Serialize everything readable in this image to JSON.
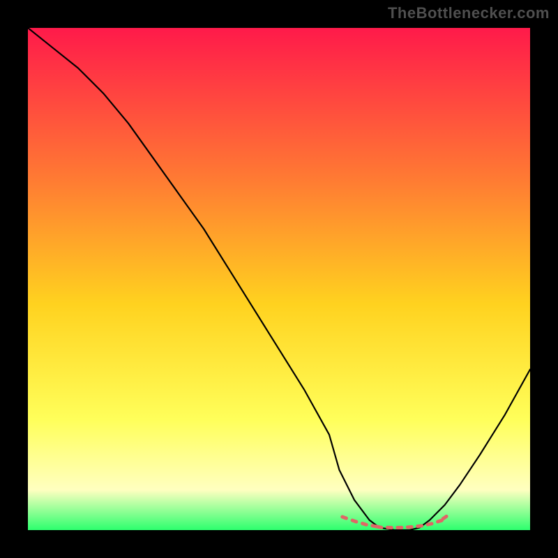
{
  "watermark": "TheBottlenecker.com",
  "chart_data": {
    "type": "line",
    "title": "",
    "xlabel": "",
    "ylabel": "",
    "xlim": [
      0,
      100
    ],
    "ylim": [
      0,
      100
    ],
    "series": [
      {
        "name": "bottleneck-curve",
        "x": [
          0,
          5,
          10,
          15,
          20,
          25,
          30,
          35,
          40,
          45,
          50,
          55,
          60,
          62,
          65,
          68,
          70,
          73,
          76,
          78,
          80,
          83,
          86,
          90,
          95,
          100
        ],
        "values": [
          100,
          96,
          92,
          87,
          81,
          74,
          67,
          60,
          52,
          44,
          36,
          28,
          19,
          12,
          6,
          2,
          0.5,
          0,
          0,
          0.5,
          2,
          5,
          9,
          15,
          23,
          32
        ]
      },
      {
        "name": "optimal-range-markers",
        "x": [
          63,
          65,
          67,
          69,
          70,
          72,
          74,
          76,
          78,
          80,
          82,
          83
        ],
        "values": [
          2.5,
          1.8,
          1.2,
          0.8,
          0.6,
          0.5,
          0.5,
          0.6,
          0.8,
          1.2,
          1.8,
          2.5
        ]
      }
    ],
    "background_gradient": {
      "top": "#ff1a4a",
      "mid_upper": "#ff7a33",
      "mid": "#ffd21f",
      "mid_lower": "#ffff5a",
      "lower": "#ffffc0",
      "bottom": "#2cff6e"
    },
    "curve_color": "#000000",
    "marker_color": "#e06666"
  }
}
